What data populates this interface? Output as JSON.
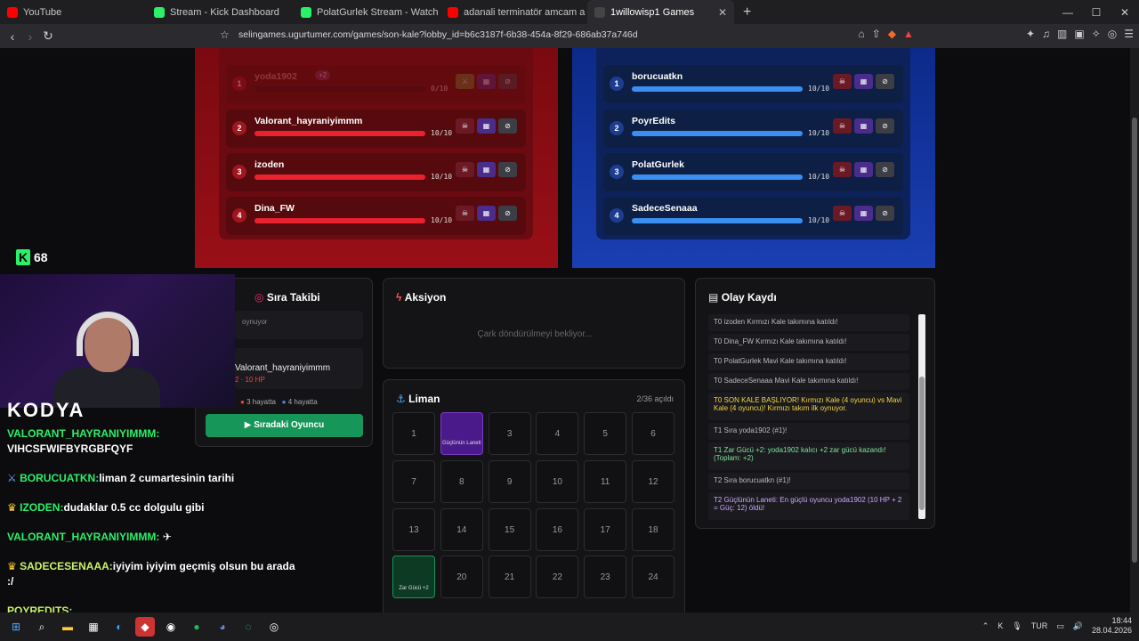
{
  "tabs": [
    {
      "title": "YouTube",
      "color": "#ff0000"
    },
    {
      "title": "Stream - Kick Dashboard",
      "color": "#2cf06a"
    },
    {
      "title": "PolatGurlek Stream - Watch Live on K",
      "color": "#2cf06a"
    },
    {
      "title": "adanali terminatör amcam a dondurm",
      "color": "#ff0000"
    },
    {
      "title": "1willowisp1 Games",
      "color": "#333333"
    }
  ],
  "url": "selingames.ugurtumer.com/games/son-kale?lobby_id=b6c3187f-6b38-454a-8f29-686ab37a746d",
  "red_team": [
    {
      "num": "1",
      "name": "yoda1902",
      "hp": "0/10",
      "badge": "+2",
      "faded": true
    },
    {
      "num": "2",
      "name": "Valorant_hayraniyimmm",
      "hp": "10/10"
    },
    {
      "num": "3",
      "name": "izoden",
      "hp": "10/10"
    },
    {
      "num": "4",
      "name": "Dina_FW",
      "hp": "10/10"
    }
  ],
  "blue_team": [
    {
      "num": "1",
      "name": "borucuatkn",
      "hp": "10/10"
    },
    {
      "num": "2",
      "name": "PoyrEdits",
      "hp": "10/10"
    },
    {
      "num": "3",
      "name": "PolatGurlek",
      "hp": "10/10"
    },
    {
      "num": "4",
      "name": "SadeceSenaaa",
      "hp": "10/10"
    }
  ],
  "kick": {
    "viewers": "68"
  },
  "turn": {
    "title": "Sıra Takibi",
    "playing": "oynuyor",
    "current": "Valorant_hayraniyimmm",
    "current_hp": "2 · 10 HP",
    "red_alive": "3 hayatta",
    "blue_alive": "4 hayatta",
    "next_button": "Sıradaki Oyuncu"
  },
  "action": {
    "title": "Aksiyon",
    "waiting": "Çark döndürülmeyi bekliyor..."
  },
  "harbor": {
    "title": "Liman",
    "opened": "2/36 açıldı",
    "tiles": [
      "1",
      "Güçlünün Laneti",
      "3",
      "4",
      "5",
      "6",
      "7",
      "8",
      "9",
      "10",
      "11",
      "12",
      "13",
      "14",
      "15",
      "16",
      "17",
      "18",
      "Zar Gücü +2",
      "20",
      "21",
      "22",
      "23",
      "24"
    ]
  },
  "log": {
    "title": "Olay Kaydı",
    "entries": [
      "T0 izoden Kırmızı Kale takımına katıldı!",
      "T0 Dina_FW Kırmızı Kale takımına katıldı!",
      "T0 PolatGurlek Mavi Kale takımına katıldı!",
      "T0 SadeceSenaaa Mavi Kale takımına katıldı!",
      "T0 SON KALE BAŞLIYOR! Kırmızı Kale (4 oyuncu) vs Mavi Kale (4 oyuncu)! Kırmızı takım ilk oynuyor.",
      "T1 Sıra yoda1902 (#1)!",
      "T1 Zar Gücü +2: yoda1902 kalıcı +2 zar gücü kazandı! (Toplam: +2)",
      "T2 Sıra borucuatkn (#1)!",
      "T2 Güçlünün Laneti: En güçlü oyuncu yoda1902 (10 HP + 2 = Güç: 12) öldü!"
    ]
  },
  "chat": [
    {
      "user": "KODYA",
      "text": ""
    },
    {
      "user": "VALORANT_HAYRANIYIMMM:",
      "text": "VIHCSFWIFBYRGBFQYF"
    },
    {
      "user": "BORUCUATKN:",
      "text": "liman 2 cumartesinin tarihi"
    },
    {
      "user": "IZODEN:",
      "text": "dudaklar 0.5 cc dolgulu gibi"
    },
    {
      "user": "VALORANT_HAYRANIYIMMM:",
      "text": ""
    },
    {
      "user": "SADECESENAAA:",
      "text": "iyiyim iyiyim geçmiş olsun bu arada :/"
    },
    {
      "user": "POYREDITS:",
      "text": ""
    }
  ],
  "tray": {
    "lang": "TUR",
    "time": "18:44",
    "date": "28.04.2026"
  }
}
